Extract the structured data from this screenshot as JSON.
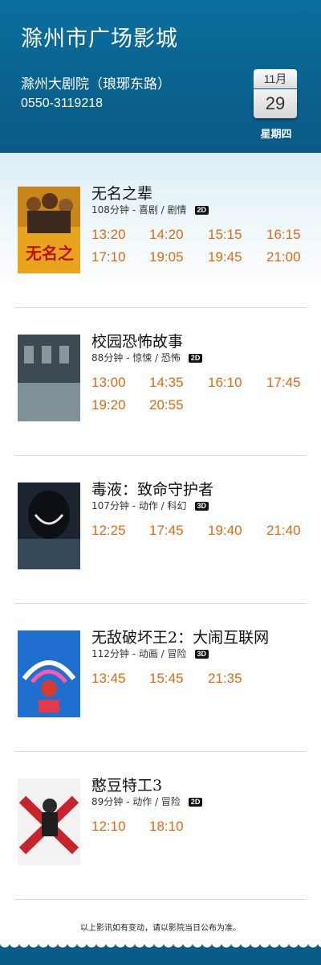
{
  "header": {
    "title": "滁州市广场影城",
    "venue": "滁州大剧院（琅琊东路）",
    "phone": "0550-3119218",
    "calendar": {
      "month": "11月",
      "day": "29",
      "weekday": "星期四"
    }
  },
  "movies": [
    {
      "title": "无名之辈",
      "meta": "108分钟 - 喜剧 / 剧情",
      "format": "2D",
      "times": [
        "13:20",
        "14:20",
        "15:15",
        "16:15",
        "17:10",
        "19:05",
        "19:45",
        "21:00"
      ]
    },
    {
      "title": "校园恐怖故事",
      "meta": "88分钟 - 惊悚 / 恐怖",
      "format": "2D",
      "times": [
        "13:00",
        "14:35",
        "16:10",
        "17:45",
        "19:20",
        "20:55"
      ]
    },
    {
      "title": "毒液：致命守护者",
      "meta": "107分钟 - 动作 / 科幻",
      "format": "3D",
      "times": [
        "12:25",
        "17:45",
        "19:40",
        "21:40"
      ]
    },
    {
      "title": "无敌破坏王2：大闹互联网",
      "meta": "112分钟 - 动画 / 冒险",
      "format": "3D",
      "times": [
        "13:45",
        "15:45",
        "21:35"
      ]
    },
    {
      "title": "憨豆特工3",
      "meta": "89分钟 - 动作 / 冒险",
      "format": "2D",
      "times": [
        "12:10",
        "18:10"
      ]
    }
  ],
  "footer": {
    "note": "以上影讯如有变动，请以影院当日公布为准。"
  },
  "colors": {
    "header": "#0a5f8b",
    "time": "#e06a10"
  }
}
